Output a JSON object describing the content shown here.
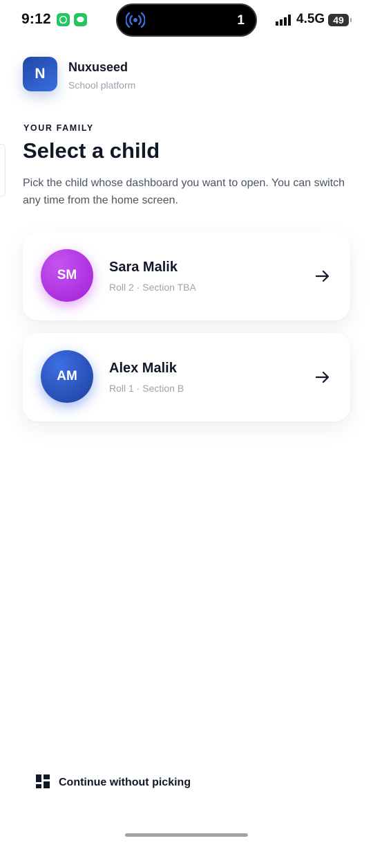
{
  "status_bar": {
    "time": "9:12",
    "island_count": "1",
    "network": "4.5G",
    "battery": "49",
    "icons": [
      "whatsapp-icon",
      "messages-icon",
      "hotspot-icon",
      "signal-icon"
    ]
  },
  "brand": {
    "logo_letter": "N",
    "name": "Nuxuseed",
    "subtitle": "School platform",
    "accent": "#2a56c6"
  },
  "section": {
    "eyebrow": "YOUR FAMILY",
    "title": "Select a child",
    "description": "Pick the child whose dashboard you want to open. You can switch any time from the home screen."
  },
  "children": [
    {
      "initials": "SM",
      "name": "Sara Malik",
      "meta": "Roll 2 · Section TBA",
      "color": "#b43ae6",
      "icon": "arrow-right-icon"
    },
    {
      "initials": "AM",
      "name": "Alex Malik",
      "meta": "Roll 1 · Section B",
      "color": "#2f5cc9",
      "icon": "arrow-right-icon"
    }
  ],
  "footer": {
    "continue_label": "Continue without picking",
    "icon": "dashboard-icon"
  }
}
